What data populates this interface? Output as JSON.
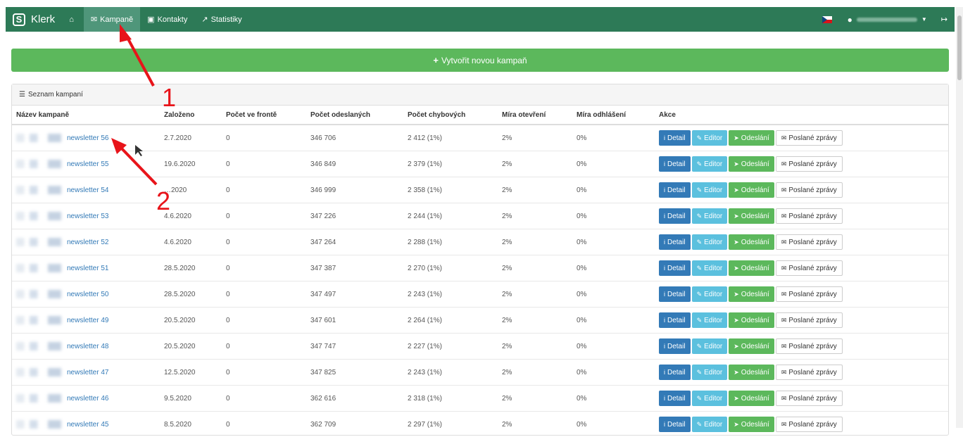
{
  "nav": {
    "brand": "Klerk",
    "items": [
      {
        "label": "Kampaně",
        "icon": "envelope-icon",
        "active": true
      },
      {
        "label": "Kontakty",
        "icon": "address-book-icon",
        "active": false
      },
      {
        "label": "Statistiky",
        "icon": "chart-icon",
        "active": false
      }
    ]
  },
  "create_button": "Vytvořit novou kampaň",
  "panel": {
    "title": "Seznam kampaní"
  },
  "table": {
    "headers": [
      "Název kampaně",
      "Založeno",
      "Počet ve frontě",
      "Počet odeslaných",
      "Počet chybových",
      "Míra otevření",
      "Míra odhlášení",
      "Akce"
    ],
    "action_labels": {
      "detail": "Detail",
      "editor": "Editor",
      "send": "Odeslání",
      "sent": "Poslané zprávy"
    },
    "rows": [
      {
        "name": "newsletter 56",
        "created": "2.7.2020",
        "queue": "0",
        "sent": "346 706",
        "errors": "2 412 (1%)",
        "open_rate": "2%",
        "unsub_rate": "0%"
      },
      {
        "name": "newsletter 55",
        "created": "19.6.2020",
        "queue": "0",
        "sent": "346 849",
        "errors": "2 379 (1%)",
        "open_rate": "2%",
        "unsub_rate": "0%"
      },
      {
        "name": "newsletter 54",
        "created": "…2020",
        "queue": "0",
        "sent": "346 999",
        "errors": "2 358 (1%)",
        "open_rate": "2%",
        "unsub_rate": "0%"
      },
      {
        "name": "newsletter 53",
        "created": "4.6.2020",
        "queue": "0",
        "sent": "347 226",
        "errors": "2 244 (1%)",
        "open_rate": "2%",
        "unsub_rate": "0%"
      },
      {
        "name": "newsletter 52",
        "created": "4.6.2020",
        "queue": "0",
        "sent": "347 264",
        "errors": "2 288 (1%)",
        "open_rate": "2%",
        "unsub_rate": "0%"
      },
      {
        "name": "newsletter 51",
        "created": "28.5.2020",
        "queue": "0",
        "sent": "347 387",
        "errors": "2 270 (1%)",
        "open_rate": "2%",
        "unsub_rate": "0%"
      },
      {
        "name": "newsletter 50",
        "created": "28.5.2020",
        "queue": "0",
        "sent": "347 497",
        "errors": "2 243 (1%)",
        "open_rate": "2%",
        "unsub_rate": "0%"
      },
      {
        "name": "newsletter 49",
        "created": "20.5.2020",
        "queue": "0",
        "sent": "347 601",
        "errors": "2 264 (1%)",
        "open_rate": "2%",
        "unsub_rate": "0%"
      },
      {
        "name": "newsletter 48",
        "created": "20.5.2020",
        "queue": "0",
        "sent": "347 747",
        "errors": "2 227 (1%)",
        "open_rate": "2%",
        "unsub_rate": "0%"
      },
      {
        "name": "newsletter 47",
        "created": "12.5.2020",
        "queue": "0",
        "sent": "347 825",
        "errors": "2 243 (1%)",
        "open_rate": "2%",
        "unsub_rate": "0%"
      },
      {
        "name": "newsletter 46",
        "created": "9.5.2020",
        "queue": "0",
        "sent": "362 616",
        "errors": "2 318 (1%)",
        "open_rate": "2%",
        "unsub_rate": "0%"
      },
      {
        "name": "newsletter 45",
        "created": "8.5.2020",
        "queue": "0",
        "sent": "362 709",
        "errors": "2 297 (1%)",
        "open_rate": "2%",
        "unsub_rate": "0%"
      }
    ]
  },
  "annotations": [
    "1",
    "2"
  ],
  "colors": {
    "navbar": "#2d7a57",
    "success": "#5cb85c",
    "primary": "#337ab7",
    "info": "#5bc0de",
    "annotation": "#e8141a"
  }
}
